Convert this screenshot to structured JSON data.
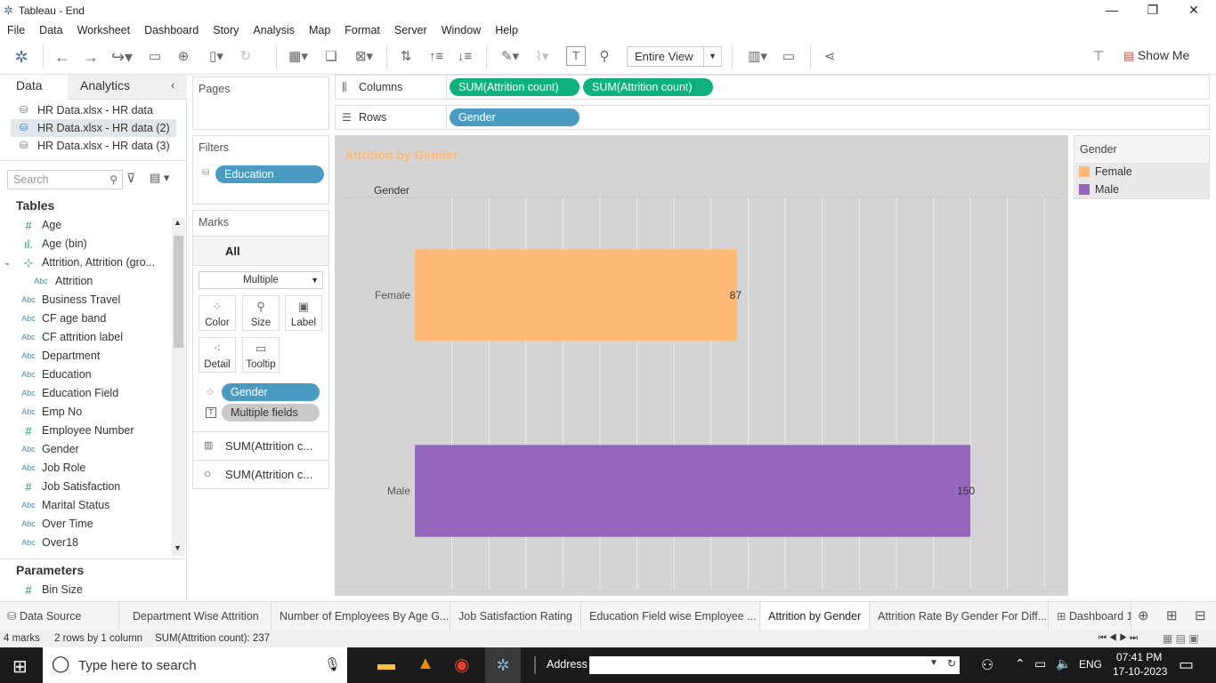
{
  "window": {
    "title": "Tableau - End"
  },
  "menu": [
    "File",
    "Data",
    "Worksheet",
    "Dashboard",
    "Story",
    "Analysis",
    "Map",
    "Format",
    "Server",
    "Window",
    "Help"
  ],
  "toolbar": {
    "view_select": "Entire View",
    "show_me": "Show Me"
  },
  "left_pane": {
    "tabs": {
      "data": "Data",
      "analytics": "Analytics"
    },
    "data_sources": [
      "HR Data.xlsx - HR data",
      "HR Data.xlsx - HR data (2)",
      "HR Data.xlsx - HR data (3)"
    ],
    "search_placeholder": "Search",
    "tables_heading": "Tables",
    "fields": [
      {
        "type": "#",
        "name": "Age"
      },
      {
        "type": "bin",
        "name": "Age (bin)"
      },
      {
        "type": "grp",
        "name": "Attrition, Attrition (gro..."
      },
      {
        "type": "Abc",
        "name": "Attrition"
      },
      {
        "type": "Abc",
        "name": "Business Travel"
      },
      {
        "type": "Abc",
        "name": "CF age band"
      },
      {
        "type": "Abc",
        "name": "CF attrition label"
      },
      {
        "type": "Abc",
        "name": "Department"
      },
      {
        "type": "Abc",
        "name": "Education"
      },
      {
        "type": "Abc",
        "name": "Education Field"
      },
      {
        "type": "Abc",
        "name": "Emp No"
      },
      {
        "type": "#",
        "name": "Employee Number"
      },
      {
        "type": "Abc",
        "name": "Gender"
      },
      {
        "type": "Abc",
        "name": "Job Role"
      },
      {
        "type": "#",
        "name": "Job Satisfaction"
      },
      {
        "type": "Abc",
        "name": "Marital Status"
      },
      {
        "type": "Abc",
        "name": "Over Time"
      },
      {
        "type": "Abc",
        "name": "Over18"
      }
    ],
    "parameters_heading": "Parameters",
    "parameters": [
      {
        "type": "#",
        "name": "Bin Size"
      }
    ]
  },
  "shelves": {
    "pages_label": "Pages",
    "filters_label": "Filters",
    "filter_pill": "Education",
    "marks_label": "Marks",
    "marks_all": "All",
    "mark_type": "Multiple",
    "mark_buttons": [
      "Color",
      "Size",
      "Label",
      "Detail",
      "Tooltip"
    ],
    "mark_pills": [
      "Gender",
      "Multiple fields"
    ],
    "mark_cards": [
      "SUM(Attrition c...",
      "SUM(Attrition c..."
    ],
    "columns_label": "Columns",
    "columns_pills": [
      "SUM(Attrition count)",
      "SUM(Attrition count)"
    ],
    "rows_label": "Rows",
    "rows_pill": "Gender"
  },
  "chart_data": {
    "type": "bar",
    "title": "Attrition by Gender",
    "row_header": "Gender",
    "categories": [
      "Female",
      "Male"
    ],
    "values": [
      87,
      150
    ],
    "xlim": [
      0,
      174
    ],
    "colors": [
      "#ffb977",
      "#9467bd"
    ],
    "legend": {
      "title": "Gender",
      "entries": [
        "Female",
        "Male"
      ],
      "placement": "right"
    }
  },
  "sheet_tabs": [
    "Data Source",
    "Department Wise Attrition",
    "Number of Employees By Age G...",
    "Job Satisfaction Rating",
    "Education Field wise Employee ...",
    "Attrition by Gender",
    "Attrition Rate By Gender For Diff...",
    "Dashboard 1"
  ],
  "status": {
    "marks": "4 marks",
    "dims": "2 rows by 1 column",
    "sum": "SUM(Attrition count): 237"
  },
  "taskbar": {
    "search": "Type here to search",
    "address": "Address",
    "lang": "ENG",
    "time": "07:41 PM",
    "date": "17-10-2023"
  }
}
